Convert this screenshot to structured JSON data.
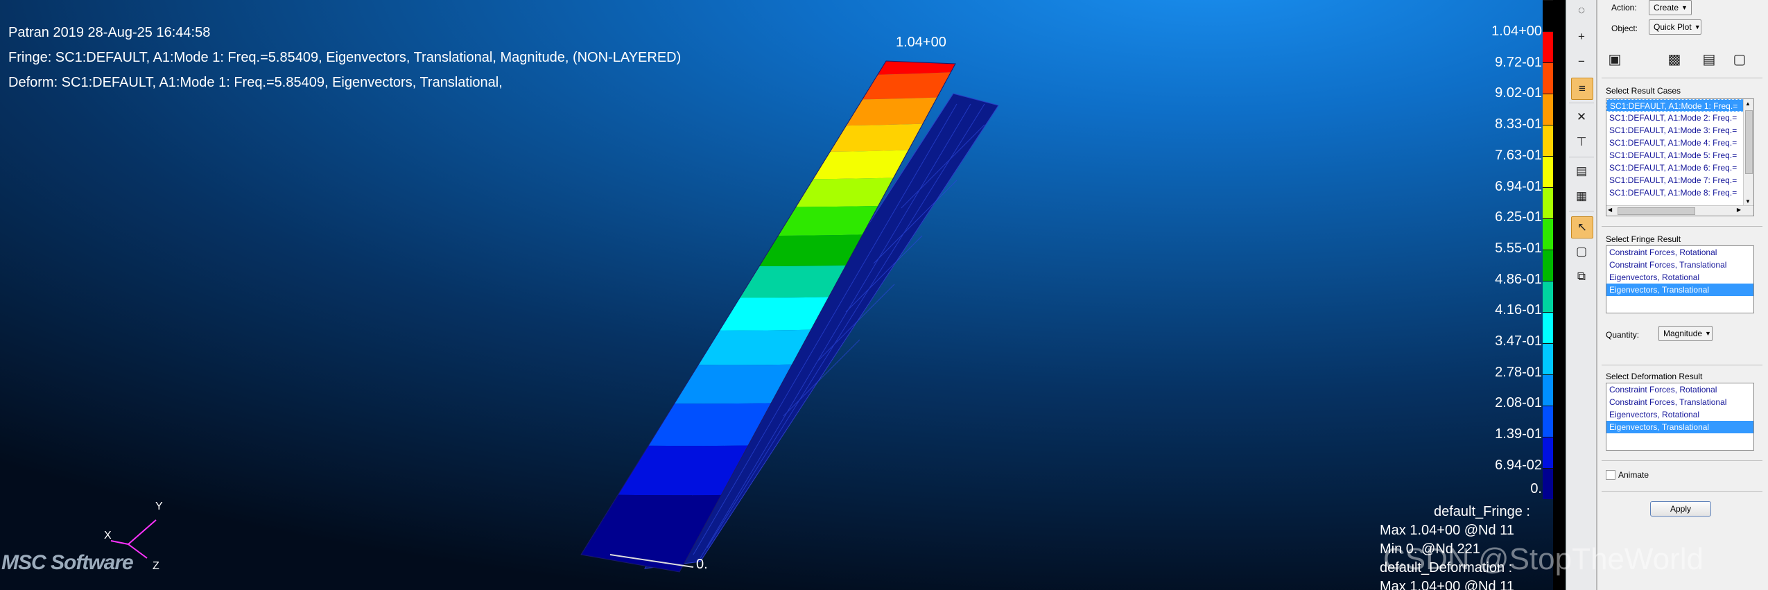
{
  "viewport": {
    "header_line1": "Patran 2019 28-Aug-25 16:44:58",
    "header_line2": "Fringe: SC1:DEFAULT, A1:Mode 1: Freq.=5.85409, Eigenvectors, Translational, Magnitude, (NON-LAYERED)",
    "header_line3": "Deform: SC1:DEFAULT, A1:Mode 1: Freq.=5.85409, Eigenvectors, Translational,",
    "max_label": "1.04+00",
    "min_label": "0.",
    "axis_y": "Y",
    "axis_x": "X",
    "axis_z": "Z",
    "logo": "MSC Software",
    "watermark": "CSDN @StopTheWorld",
    "summary": {
      "fringe_title": "default_Fringe :",
      "fringe_max": "Max 1.04+00 @Nd 11",
      "fringe_min": "Min  0. @Nd 221",
      "deform_title": "default_Deformation :",
      "deform_max": "Max 1.04+00 @Nd 11"
    }
  },
  "legend": {
    "labels": [
      "1.04+00",
      "9.72-01",
      "9.02-01",
      "8.33-01",
      "7.63-01",
      "6.94-01",
      "6.25-01",
      "5.55-01",
      "4.86-01",
      "4.16-01",
      "3.47-01",
      "2.78-01",
      "2.08-01",
      "1.39-01",
      "6.94-02",
      "0."
    ],
    "colors": [
      "#000000",
      "#ff0000",
      "#ff4a00",
      "#ff9a00",
      "#ffd200",
      "#f4ff00",
      "#a8ff00",
      "#2ee800",
      "#00b800",
      "#00d4a0",
      "#00ffff",
      "#00c8ff",
      "#0090ff",
      "#0050ff",
      "#0010e0",
      "#00008f"
    ]
  },
  "toolstrip": {
    "icons": [
      "lasso-icon",
      "zoom-in-icon",
      "zoom-out-icon",
      "fit-view-icon",
      "pin-icon",
      "fringe-icon",
      "frame-icon",
      "grid-icon",
      "select-arrow-icon",
      "open-icon",
      "copy-icon"
    ]
  },
  "panel": {
    "action_label": "Action:",
    "action_value": "Create",
    "object_label": "Object:",
    "object_value": "Quick Plot",
    "result_cases_title": "Select Result Cases",
    "result_cases": [
      "SC1:DEFAULT, A1:Mode 1: Freq.=",
      "SC1:DEFAULT, A1:Mode 2: Freq.=",
      "SC1:DEFAULT, A1:Mode 3: Freq.=",
      "SC1:DEFAULT, A1:Mode 4: Freq.=",
      "SC1:DEFAULT, A1:Mode 5: Freq.=",
      "SC1:DEFAULT, A1:Mode 6: Freq.=",
      "SC1:DEFAULT, A1:Mode 7: Freq.=",
      "SC1:DEFAULT, A1:Mode 8: Freq.="
    ],
    "fringe_title": "Select Fringe Result",
    "fringe_results": [
      "Constraint Forces, Rotational",
      "Constraint Forces, Translational",
      "Eigenvectors, Rotational",
      "Eigenvectors, Translational"
    ],
    "quantity_label": "Quantity:",
    "quantity_value": "Magnitude",
    "deform_title": "Select Deformation Result",
    "deform_results": [
      "Constraint Forces, Rotational",
      "Constraint Forces, Translational",
      "Eigenvectors, Rotational",
      "Eigenvectors, Translational"
    ],
    "animate_label": "Animate",
    "apply_label": "Apply"
  }
}
